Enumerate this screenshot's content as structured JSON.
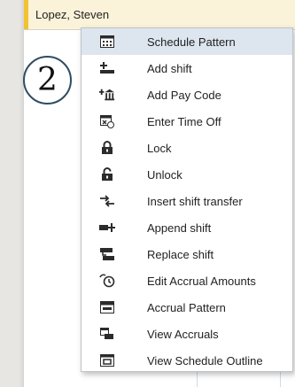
{
  "row": {
    "employee_name": "Lopez, Steven"
  },
  "step_badge": {
    "number": "2"
  },
  "menu": {
    "items": [
      {
        "label": "Schedule Pattern",
        "icon": "calendar-grid-icon",
        "highlighted": true
      },
      {
        "label": "Add shift",
        "icon": "add-shift-icon"
      },
      {
        "label": "Add Pay Code",
        "icon": "add-pay-code-icon"
      },
      {
        "label": "Enter Time Off",
        "icon": "time-off-icon"
      },
      {
        "label": "Lock",
        "icon": "lock-icon"
      },
      {
        "label": "Unlock",
        "icon": "unlock-icon"
      },
      {
        "label": "Insert shift transfer",
        "icon": "shift-transfer-icon"
      },
      {
        "label": "Append shift",
        "icon": "append-shift-icon"
      },
      {
        "label": "Replace shift",
        "icon": "replace-shift-icon"
      },
      {
        "label": "Edit Accrual Amounts",
        "icon": "edit-accrual-icon"
      },
      {
        "label": "Accrual Pattern",
        "icon": "accrual-pattern-icon"
      },
      {
        "label": "View Accruals",
        "icon": "view-accruals-icon"
      },
      {
        "label": "View Schedule Outline",
        "icon": "schedule-outline-icon"
      }
    ]
  },
  "colors": {
    "row_highlight": "#fbf3d9",
    "row_accent": "#f1c232",
    "menu_highlight": "#dde5ef",
    "icon": "#2b2b2b"
  }
}
